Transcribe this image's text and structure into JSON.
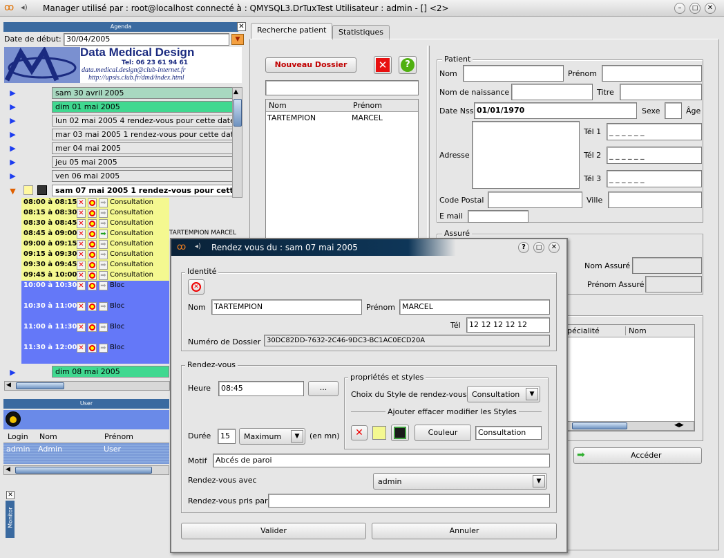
{
  "window": {
    "title": "Manager utilisé par : root@localhost connecté à : QMYSQL3.DrTuxTest Utilisateur : admin - [] <2>"
  },
  "agenda": {
    "header": "Agenda",
    "start_label": "Date de début:",
    "start_value": "30/04/2005",
    "banner": {
      "name": "Data Medical Design",
      "tel": "Tel: 06 23 61 94 61",
      "email": "data.medical.design@club-internet.fr",
      "url": "http://upsis.club.fr/dmd/index.html"
    },
    "days": [
      {
        "label": "sam 30 avril 2005",
        "color": "#a8d8c0"
      },
      {
        "label": "dim 01 mai 2005",
        "color": "#40d890"
      },
      {
        "label": "lun 02 mai 2005   4 rendez-vous pour cette date",
        "color": "#e6e6e6"
      },
      {
        "label": "mar 03 mai 2005  1 rendez-vous pour cette date",
        "color": "#e6e6e6"
      },
      {
        "label": "mer 04 mai 2005",
        "color": "#e6e6e6"
      },
      {
        "label": "jeu 05 mai 2005",
        "color": "#e6e6e6"
      },
      {
        "label": "ven 06 mai 2005",
        "color": "#e6e6e6"
      }
    ],
    "open_day": "sam 07 mai 2005 1 rendez-vous pour cette date",
    "slots": [
      {
        "time": "08:00 à 08:15",
        "type": "Consultation",
        "patient": ""
      },
      {
        "time": "08:15 à 08:30",
        "type": "Consultation",
        "patient": ""
      },
      {
        "time": "08:30 à 08:45",
        "type": "Consultation",
        "patient": ""
      },
      {
        "time": "08:45 à 09:00",
        "type": "Consultation",
        "patient": "TARTEMPION MARCEL"
      },
      {
        "time": "09:00 à 09:15",
        "type": "Consultation",
        "patient": ""
      },
      {
        "time": "09:15 à 09:30",
        "type": "Consultation",
        "patient": ""
      },
      {
        "time": "09:30 à 09:45",
        "type": "Consultation",
        "patient": ""
      },
      {
        "time": "09:45 à 10:00",
        "type": "Consultation",
        "patient": ""
      }
    ],
    "bloc_slots": [
      {
        "time": "10:00 à 10:30",
        "type": "Bloc"
      },
      {
        "time": "10:30 à 11:00",
        "type": "Bloc"
      },
      {
        "time": "11:00 à 11:30",
        "type": "Bloc"
      },
      {
        "time": "11:30 à 12:00",
        "type": "Bloc"
      }
    ],
    "next_day": "dim 08 mai 2005",
    "slot_colors": {
      "consultation": "#f4f890",
      "bloc": "#6478f8"
    }
  },
  "user_panel": {
    "header": "User",
    "columns": [
      "Login",
      "Nom",
      "Prénom"
    ],
    "rows": [
      {
        "login": "admin",
        "nom": "Admin",
        "prenom": "User"
      }
    ]
  },
  "monitor": {
    "label": "Monitor"
  },
  "tabs": [
    "Recherche patient",
    "Statistiques"
  ],
  "search": {
    "new_button": "Nouveau Dossier",
    "list_columns": [
      "Nom",
      "Prénom"
    ],
    "list_rows": [
      {
        "nom": "TARTEMPION",
        "prenom": "MARCEL"
      }
    ]
  },
  "patient": {
    "group": "Patient",
    "nom": "Nom",
    "prenom": "Prénom",
    "nom_naissance": "Nom de naissance",
    "titre": "Titre",
    "date_nss": "Date Nss",
    "date_nss_value": "01/01/1970",
    "sexe": "Sexe",
    "age": "Âge",
    "adresse": "Adresse",
    "tel1": "Tél 1",
    "tel2": "Tél 2",
    "tel3": "Tél 3",
    "tel_placeholder": "_ _  _ _ _ _",
    "code_postal": "Code Postal",
    "ville": "Ville",
    "email": "E mail"
  },
  "assure": {
    "group": "Assuré",
    "nom": "Nom Assuré",
    "prenom": "Prénom Assuré"
  },
  "right_list": {
    "columns": [
      "pécialité",
      "Nom"
    ]
  },
  "acceder": "Accéder",
  "dialog": {
    "title": "Rendez vous du : sam 07 mai 2005",
    "identite": {
      "group": "Identité",
      "nom_label": "Nom",
      "nom_value": "TARTEMPION",
      "prenom_label": "Prénom",
      "prenom_value": "MARCEL",
      "tel_label": "Tél",
      "tel_value": "12 12 12 12 12",
      "dossier_label": "Numéro de Dossier",
      "dossier_value": "30DC82DD-7632-2C46-9DC3-BC1AC0ECD20A"
    },
    "rdv": {
      "group": "Rendez-vous",
      "heure_label": "Heure",
      "heure_value": "08:45",
      "heure_button": "...",
      "duree_label": "Durée",
      "duree_value": "15",
      "duree_mode": "Maximum",
      "duree_unit": "(en mn)",
      "motif_label": "Motif",
      "motif_value": "Abcés de paroi",
      "avec_label": "Rendez-vous avec",
      "avec_value": "admin",
      "pris_label": "Rendez-vous pris par",
      "pris_value": ""
    },
    "styles": {
      "group": "propriétés et styles",
      "choix_label": "Choix du Style de rendez-vous",
      "choix_value": "Consultation",
      "sub_label": "Ajouter effacer  modifier les Styles",
      "couleur_button": "Couleur",
      "style_name": "Consultation",
      "swatch": "#f4f890"
    },
    "valider": "Valider",
    "annuler": "Annuler"
  }
}
